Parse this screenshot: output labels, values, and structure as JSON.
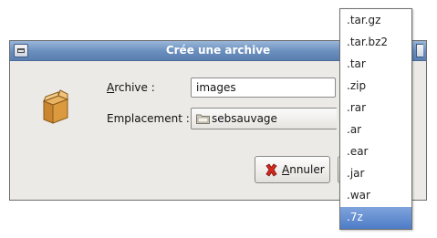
{
  "dialog": {
    "title": "Crée une archive",
    "archive_label_prefix": "",
    "archive_label_mnemonic": "A",
    "archive_label_rest": "rchive :",
    "archive_value": "images",
    "location_label": "Emplacement :",
    "location_value": "sebsauvage",
    "cancel_mnemonic": "A",
    "cancel_rest": "nnuler"
  },
  "format_menu": {
    "items": [
      ".tar.gz",
      ".tar.bz2",
      ".tar",
      ".zip",
      ".rar",
      ".ar",
      ".ear",
      ".jar",
      ".war",
      ".7z"
    ],
    "selected": ".7z"
  },
  "icons": {
    "archive": "archive-box-icon",
    "folder": "folder-icon",
    "cancel": "cancel-x-icon",
    "window_menu": "window-menu-icon"
  },
  "colors": {
    "titlebar": "#6a8ebd",
    "selection": "#4d7cc7",
    "dialog_bg": "#eceae6"
  }
}
